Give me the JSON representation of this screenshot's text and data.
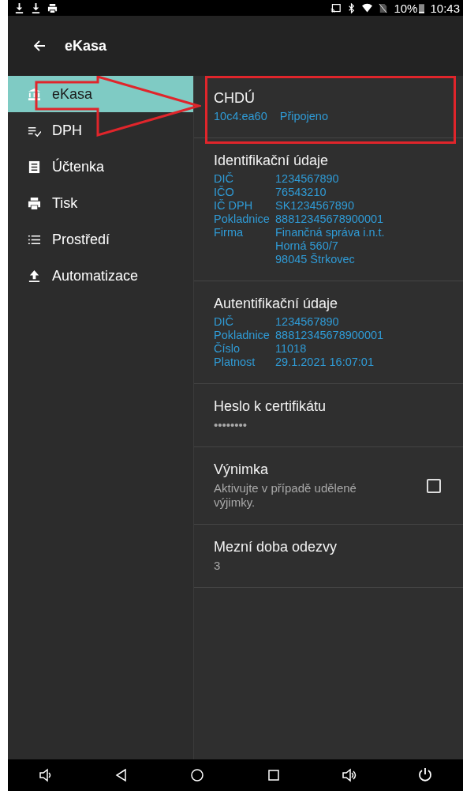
{
  "status_bar": {
    "battery": "10%",
    "time": "10:43"
  },
  "app_bar": {
    "title": "eKasa"
  },
  "sidebar": {
    "items": [
      {
        "label": "eKasa",
        "kind": "bank",
        "selected": true
      },
      {
        "label": "DPH",
        "kind": "checklist",
        "selected": false
      },
      {
        "label": "Účtenka",
        "kind": "receipt",
        "selected": false
      },
      {
        "label": "Tisk",
        "kind": "printer",
        "selected": false
      },
      {
        "label": "Prostředí",
        "kind": "list",
        "selected": false
      },
      {
        "label": "Automatizace",
        "kind": "upload",
        "selected": false
      }
    ]
  },
  "sections": [
    {
      "kind": "status",
      "title": "CHDÚ",
      "values": [
        "10c4:ea60",
        "Připojeno"
      ]
    },
    {
      "kind": "details",
      "title": "Identifikační údaje",
      "rows": [
        {
          "label": "DIČ",
          "value": [
            "1234567890"
          ]
        },
        {
          "label": "IČO",
          "value": [
            "76543210"
          ]
        },
        {
          "label": "IČ DPH",
          "value": [
            "SK1234567890"
          ]
        },
        {
          "label": "Pokladnice",
          "value": [
            "88812345678900001"
          ]
        },
        {
          "label": "Firma",
          "value": [
            "Finančná správa i.n.t.",
            "Horná 560/7",
            "98045 Štrkovec"
          ]
        }
      ]
    },
    {
      "kind": "details",
      "title": "Autentifikační údaje",
      "rows": [
        {
          "label": "DIČ",
          "value": [
            "1234567890"
          ]
        },
        {
          "label": "Pokladnice",
          "value": [
            "88812345678900001"
          ]
        },
        {
          "label": "Číslo",
          "value": [
            "11018"
          ]
        },
        {
          "label": "Platnost",
          "value": [
            "29.1.2021 16:07:01"
          ]
        }
      ]
    },
    {
      "kind": "value",
      "title": "Heslo k certifikátu",
      "value": "••••••••"
    },
    {
      "kind": "checkbox",
      "title": "Výnimka",
      "summary": "Aktivujte v případě udělené výjimky.",
      "checked": false
    },
    {
      "kind": "value",
      "title": "Mezní doba odezvy",
      "value": "3"
    }
  ]
}
